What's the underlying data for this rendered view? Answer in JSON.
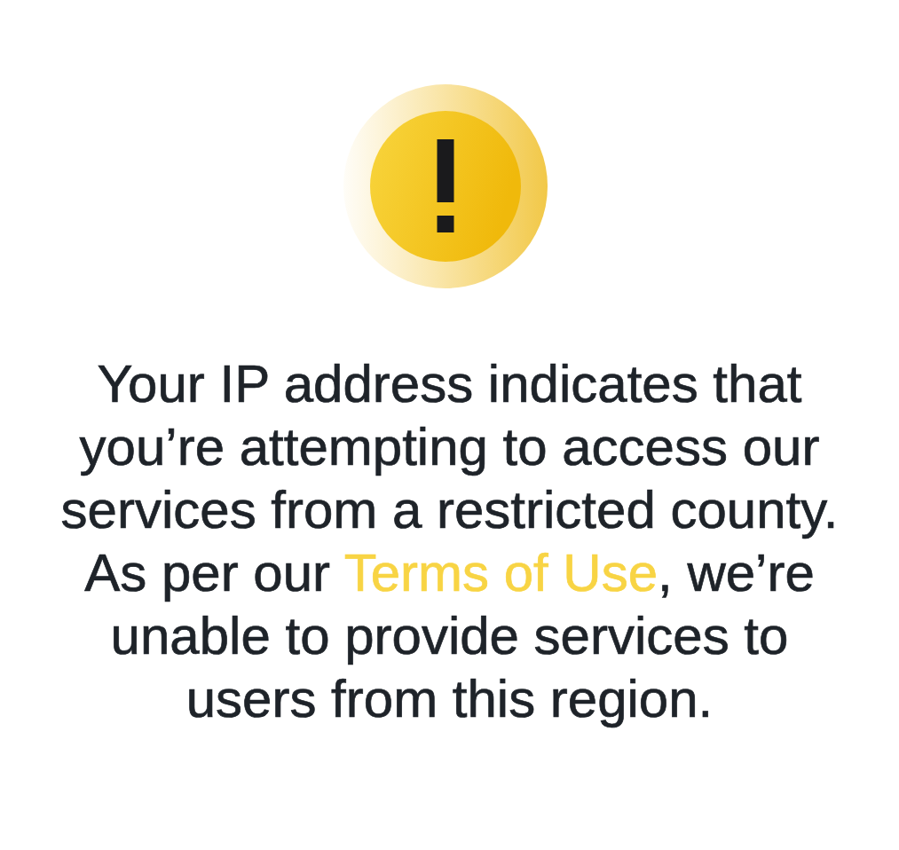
{
  "notice": {
    "message_before": "Your IP address indicates that you’re attempting to access our services from a restricted county. As per our ",
    "link": "Terms of Use",
    "message_after": ", we’re unable to provide services to users from this region."
  }
}
